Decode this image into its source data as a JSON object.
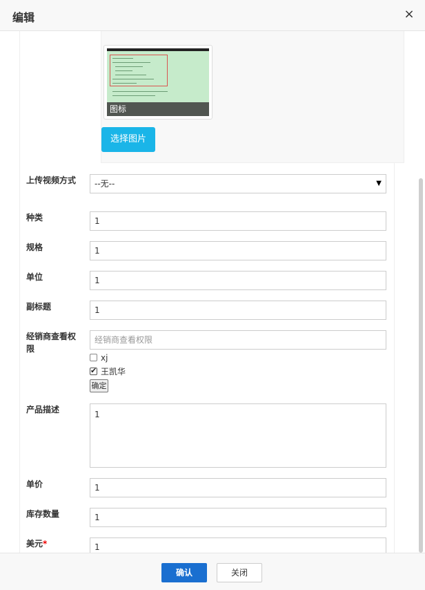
{
  "header": {
    "title": "编辑",
    "close_icon": "×"
  },
  "image_section": {
    "caption": "图标",
    "select_button": "选择图片"
  },
  "form": {
    "video_upload": {
      "label": "上传视频方式",
      "value": "--无--"
    },
    "category": {
      "label": "种类",
      "value": "1"
    },
    "spec": {
      "label": "规格",
      "value": "1"
    },
    "unit": {
      "label": "单位",
      "value": "1"
    },
    "subtitle": {
      "label": "副标题",
      "value": "1"
    },
    "dealer_permission": {
      "label": "经销商查看权限",
      "placeholder": "经销商查看权限",
      "options": [
        {
          "label": "xj",
          "checked": false
        },
        {
          "label": "王凯华",
          "checked": true
        }
      ],
      "confirm_button": "确定"
    },
    "description": {
      "label": "产品描述",
      "value": "1"
    },
    "unit_price": {
      "label": "单价",
      "value": "1"
    },
    "stock": {
      "label": "库存数量",
      "value": "1"
    },
    "usd": {
      "label": "美元",
      "required_mark": "*",
      "value": "1"
    }
  },
  "footer": {
    "ok_button": "确认",
    "close_button": "关闭"
  }
}
